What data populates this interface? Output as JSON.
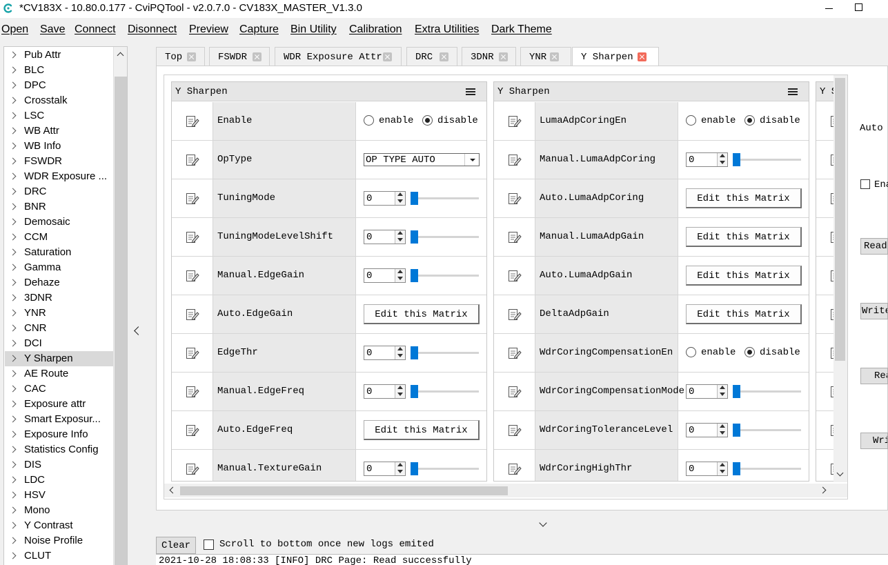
{
  "window": {
    "title": "*CV183X - 10.80.0.177 - CviPQTool - v2.0.7.0 - CV183X_MASTER_V1.3.0"
  },
  "menu": [
    "Open",
    "Save",
    "Connect",
    "Disonnect",
    "Preview",
    "Capture",
    "Bin Utility",
    "Calibration",
    "Extra Utilities",
    "Dark Theme"
  ],
  "sidebar": {
    "selected": "Y Sharpen",
    "items": [
      "Pub Attr",
      "BLC",
      "DPC",
      "Crosstalk",
      "LSC",
      "WB Attr",
      "WB Info",
      "FSWDR",
      "WDR Exposure ...",
      "DRC",
      "BNR",
      "Demosaic",
      "CCM",
      "Saturation",
      "Gamma",
      "Dehaze",
      "3DNR",
      "YNR",
      "CNR",
      "DCI",
      "Y Sharpen",
      "AE Route",
      "CAC",
      "Exposure attr",
      "Smart Exposur...",
      "Exposure Info",
      "Statistics Config",
      "DIS",
      "LDC",
      "HSV",
      "Mono",
      "Y Contrast",
      "Noise Profile",
      "CLUT"
    ]
  },
  "tabs": {
    "active": "Y Sharpen",
    "items": [
      "Top",
      "FSWDR",
      "WDR Exposure Attr",
      "DRC",
      "3DNR",
      "YNR",
      "Y Sharpen"
    ]
  },
  "controls": {
    "enable_label": "enable",
    "disable_label": "disable",
    "matrix_button_label": "Edit this Matrix",
    "accent_color": "#0078d7"
  },
  "groups": [
    {
      "title": "Y Sharpen",
      "rows": [
        {
          "label": "Enable",
          "type": "radio",
          "value": "disable"
        },
        {
          "label": "OpType",
          "type": "combo",
          "value": "OP TYPE AUTO"
        },
        {
          "label": "TuningMode",
          "type": "spin",
          "value": "0"
        },
        {
          "label": "TuningModeLevelShift",
          "type": "spin",
          "value": "0"
        },
        {
          "label": "Manual.EdgeGain",
          "type": "spin",
          "value": "0"
        },
        {
          "label": "Auto.EdgeGain",
          "type": "matrix"
        },
        {
          "label": "EdgeThr",
          "type": "spin",
          "value": "0"
        },
        {
          "label": "Manual.EdgeFreq",
          "type": "spin",
          "value": "0"
        },
        {
          "label": "Auto.EdgeFreq",
          "type": "matrix"
        },
        {
          "label": "Manual.TextureGain",
          "type": "spin",
          "value": "0"
        }
      ]
    },
    {
      "title": "Y Sharpen",
      "rows": [
        {
          "label": "LumaAdpCoringEn",
          "type": "radio",
          "value": "disable"
        },
        {
          "label": "Manual.LumaAdpCoring",
          "type": "spin",
          "value": "0"
        },
        {
          "label": "Auto.LumaAdpCoring",
          "type": "matrix"
        },
        {
          "label": "Manual.LumaAdpGain",
          "type": "matrix"
        },
        {
          "label": "Auto.LumaAdpGain",
          "type": "matrix"
        },
        {
          "label": "DeltaAdpGain",
          "type": "matrix"
        },
        {
          "label": "WdrCoringCompensationEn",
          "type": "radio",
          "value": "disable"
        },
        {
          "label": "WdrCoringCompensationMode",
          "type": "spin",
          "value": "0"
        },
        {
          "label": "WdrCoringToleranceLevel",
          "type": "spin",
          "value": "0"
        },
        {
          "label": "WdrCoringHighThr",
          "type": "spin",
          "value": "0"
        }
      ]
    },
    {
      "title": "Y S",
      "rows": []
    }
  ],
  "right_panel": {
    "auto_label": "Auto",
    "enable_check_label": "Ena",
    "buttons": [
      "Read",
      "Write",
      "Rea",
      "Wri"
    ]
  },
  "log": {
    "clear_label": "Clear",
    "scroll_checkbox_label": "Scroll to bottom once new logs emited",
    "lines": [
      "2021-10-28 18:08:33 [INFO] DRC Page: Read successfully"
    ]
  }
}
